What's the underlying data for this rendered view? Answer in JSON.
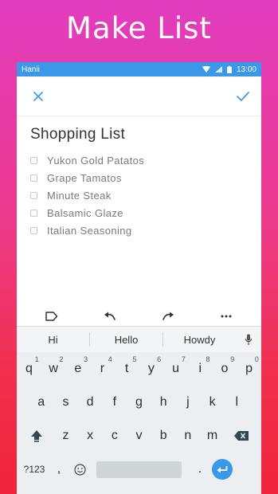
{
  "promo": {
    "headline": "Make List"
  },
  "statusbar": {
    "carrier": "Hanii",
    "time": "13:00"
  },
  "toolbar": {
    "close_icon": "close-icon",
    "confirm_icon": "check-icon"
  },
  "list": {
    "title": "Shopping List",
    "items": [
      {
        "text": "Yukon Gold Patatos",
        "checked": false
      },
      {
        "text": "Grape Tamatos",
        "checked": false
      },
      {
        "text": "Minute Steak",
        "checked": false
      },
      {
        "text": "Balsamic Glaze",
        "checked": false
      },
      {
        "text": "Italian Seasoning",
        "checked": false
      }
    ]
  },
  "editbar": {
    "tools": [
      "label-icon",
      "undo-icon",
      "redo-icon",
      "more-icon"
    ]
  },
  "keyboard": {
    "suggestions": [
      "Hi",
      "Hello",
      "Howdy"
    ],
    "row1": [
      {
        "key": "q",
        "hint": "1"
      },
      {
        "key": "w",
        "hint": "2"
      },
      {
        "key": "e",
        "hint": "3"
      },
      {
        "key": "r",
        "hint": "4"
      },
      {
        "key": "t",
        "hint": "5"
      },
      {
        "key": "y",
        "hint": "6"
      },
      {
        "key": "u",
        "hint": "7"
      },
      {
        "key": "i",
        "hint": "8"
      },
      {
        "key": "o",
        "hint": "9"
      },
      {
        "key": "p",
        "hint": "0"
      }
    ],
    "row2": [
      "a",
      "s",
      "d",
      "f",
      "g",
      "h",
      "j",
      "k",
      "l"
    ],
    "row3": [
      "z",
      "x",
      "c",
      "v",
      "b",
      "n",
      "m"
    ],
    "symbols_label": "?123",
    "comma": ",",
    "period": ".",
    "accent_color": "#3b97e8"
  }
}
